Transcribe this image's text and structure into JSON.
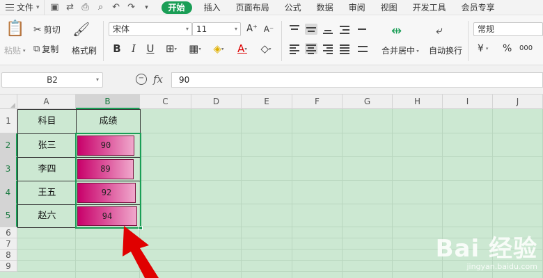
{
  "menu": {
    "file_label": "文件",
    "tabs": [
      "开始",
      "插入",
      "页面布局",
      "公式",
      "数据",
      "审阅",
      "视图",
      "开发工具",
      "会员专享"
    ],
    "active_tab": "开始"
  },
  "ribbon": {
    "paste_label": "粘贴",
    "cut_label": "剪切",
    "copy_label": "复制",
    "format_painter_label": "格式刷",
    "font_name": "宋体",
    "font_size": "11",
    "merge_center_label": "合并居中",
    "wrap_text_label": "自动换行",
    "number_format": "常规",
    "currency_symbol": "¥",
    "percent_symbol": "%",
    "comma_symbol": "000"
  },
  "formula_bar": {
    "name_box": "B2",
    "fx_label": "fx",
    "formula_value": "90"
  },
  "sheet": {
    "columns": [
      "A",
      "B",
      "C",
      "D",
      "E",
      "F",
      "G",
      "H",
      "I",
      "J"
    ],
    "rows": [
      "1",
      "2",
      "3",
      "4",
      "5",
      "6",
      "7",
      "8",
      "9"
    ],
    "header_subject": "科目",
    "header_score": "成绩",
    "records": [
      {
        "subject": "张三",
        "score": 90
      },
      {
        "subject": "李四",
        "score": 89
      },
      {
        "subject": "王五",
        "score": 92
      },
      {
        "subject": "赵六",
        "score": 94
      }
    ],
    "databar_max": 94
  },
  "colors": {
    "accent_green": "#1a9e56",
    "sheet_background": "#cce8d2",
    "databar_start": "#c8006a",
    "databar_end": "#f0a8cc"
  },
  "watermark": {
    "main": "Bai 经验",
    "sub": "jingyan.baidu.com"
  }
}
